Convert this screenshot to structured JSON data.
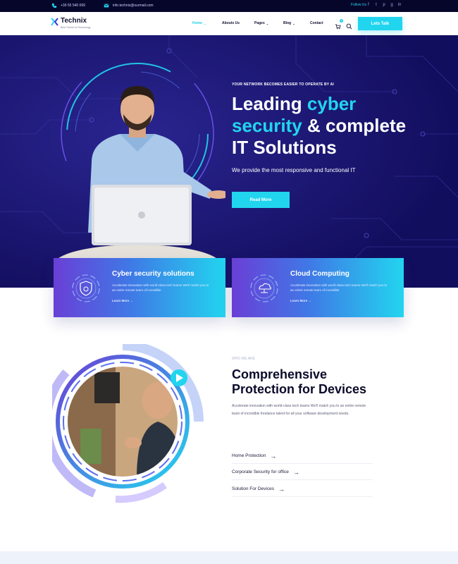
{
  "topbar": {
    "phone": "+36 55 540 069",
    "email": "info.technix@ourmail.com",
    "follow_label": "Follow Us",
    "socials": [
      "facebook-icon",
      "twitter-icon",
      "pinterest-icon",
      "github-icon",
      "linkedin-icon"
    ]
  },
  "header": {
    "logo_name": "Technix",
    "logo_tagline": "Best Theme for Technology",
    "nav": [
      {
        "label": "Home",
        "active": true,
        "has_dropdown": true
      },
      {
        "label": "Abouts Us",
        "active": false,
        "has_dropdown": false
      },
      {
        "label": "Pages",
        "active": false,
        "has_dropdown": true
      },
      {
        "label": "Blog",
        "active": false,
        "has_dropdown": true
      },
      {
        "label": "Contact",
        "active": false,
        "has_dropdown": false
      }
    ],
    "cart_count": "0",
    "cta_label": "Lets Talk"
  },
  "hero": {
    "eyebrow": "YOUR NETWORK BECOMES EASIER TO OPERATE BY AI",
    "title_line1_a": "Leading ",
    "title_line1_accent": "cyber",
    "title_line2_accent": "security",
    "title_line2_b": " & complete",
    "title_line3": "IT Solutions",
    "subtitle": "We provide the most responsive and functional IT",
    "button_label": "Read More"
  },
  "cards": [
    {
      "title": "Cyber security solutions",
      "text": "Accelerate innovation with world-class tech teams We'll match you to an entire remote team of incredible",
      "link": "Learn More →",
      "icon": "shield-lock-icon"
    },
    {
      "title": "Cloud Computing",
      "text": "Accelerate innovation with world-class tech teams We'll match you to an entire remote team of incredible",
      "link": "Learn More →",
      "icon": "cloud-network-icon"
    }
  ],
  "about": {
    "eyebrow": "WHO WE ARE",
    "title_line1": "Comprehensive",
    "title_line2": "Protection for Devices",
    "text": "Accelerate innovation with world-class tech teams We'll match you to an entire remote team of incredible freelance talent for all your software development needs.",
    "features": [
      "Home Protection",
      "Corporate Security for office",
      "Solution For Devices"
    ]
  },
  "colors": {
    "accent": "#22d5ef",
    "hero_bg": "#14106a",
    "topbar_bg": "#06062b",
    "card_gradient_start": "#6a3fd6",
    "card_gradient_end": "#22d5ef"
  }
}
